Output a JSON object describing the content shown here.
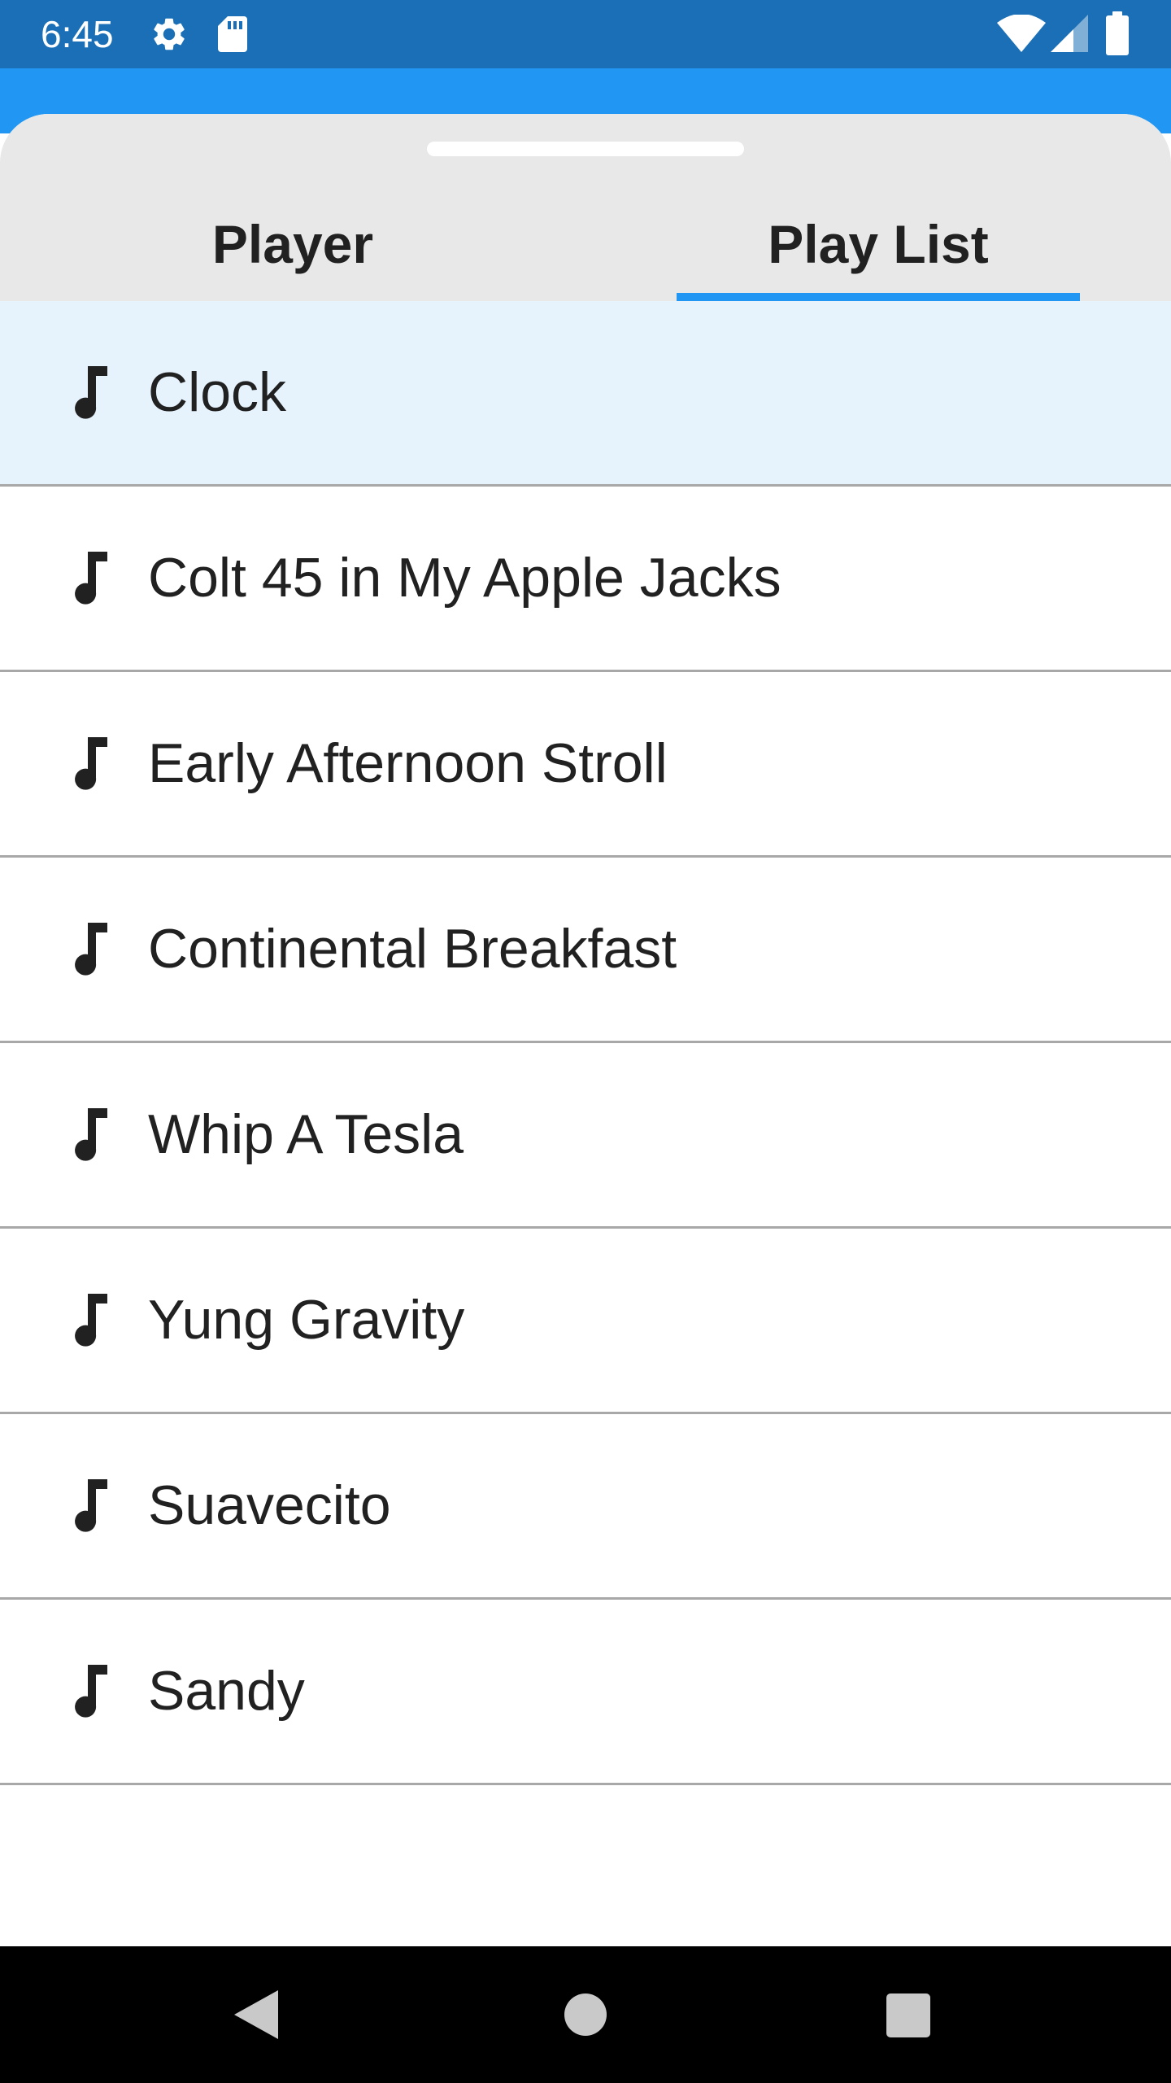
{
  "status_bar": {
    "time": "6:45",
    "left_icons": [
      "gear-icon",
      "sd-card-icon"
    ],
    "right_icons": [
      "wifi-icon",
      "cellular-signal-icon",
      "battery-icon"
    ],
    "background": "#1a6fb6"
  },
  "app_bar": {
    "background": "#2196f3"
  },
  "tabs": [
    {
      "label": "Player",
      "selected": false
    },
    {
      "label": "Play List",
      "selected": true
    }
  ],
  "colors": {
    "accent": "#2196f3",
    "selected_row": "#e6f3fd",
    "tab_header": "#e8e8e8",
    "text": "#212121"
  },
  "playlist": {
    "item_icon": "music-note-icon",
    "items": [
      {
        "title": "Clock",
        "selected": true
      },
      {
        "title": "Colt 45 in My Apple Jacks",
        "selected": false
      },
      {
        "title": "Early Afternoon Stroll",
        "selected": false
      },
      {
        "title": "Continental Breakfast",
        "selected": false
      },
      {
        "title": "Whip A Tesla",
        "selected": false
      },
      {
        "title": "Yung Gravity",
        "selected": false
      },
      {
        "title": "Suavecito",
        "selected": false
      },
      {
        "title": "Sandy",
        "selected": false
      }
    ]
  },
  "nav_bar": {
    "buttons": [
      "back-icon",
      "home-icon",
      "recents-icon"
    ]
  }
}
